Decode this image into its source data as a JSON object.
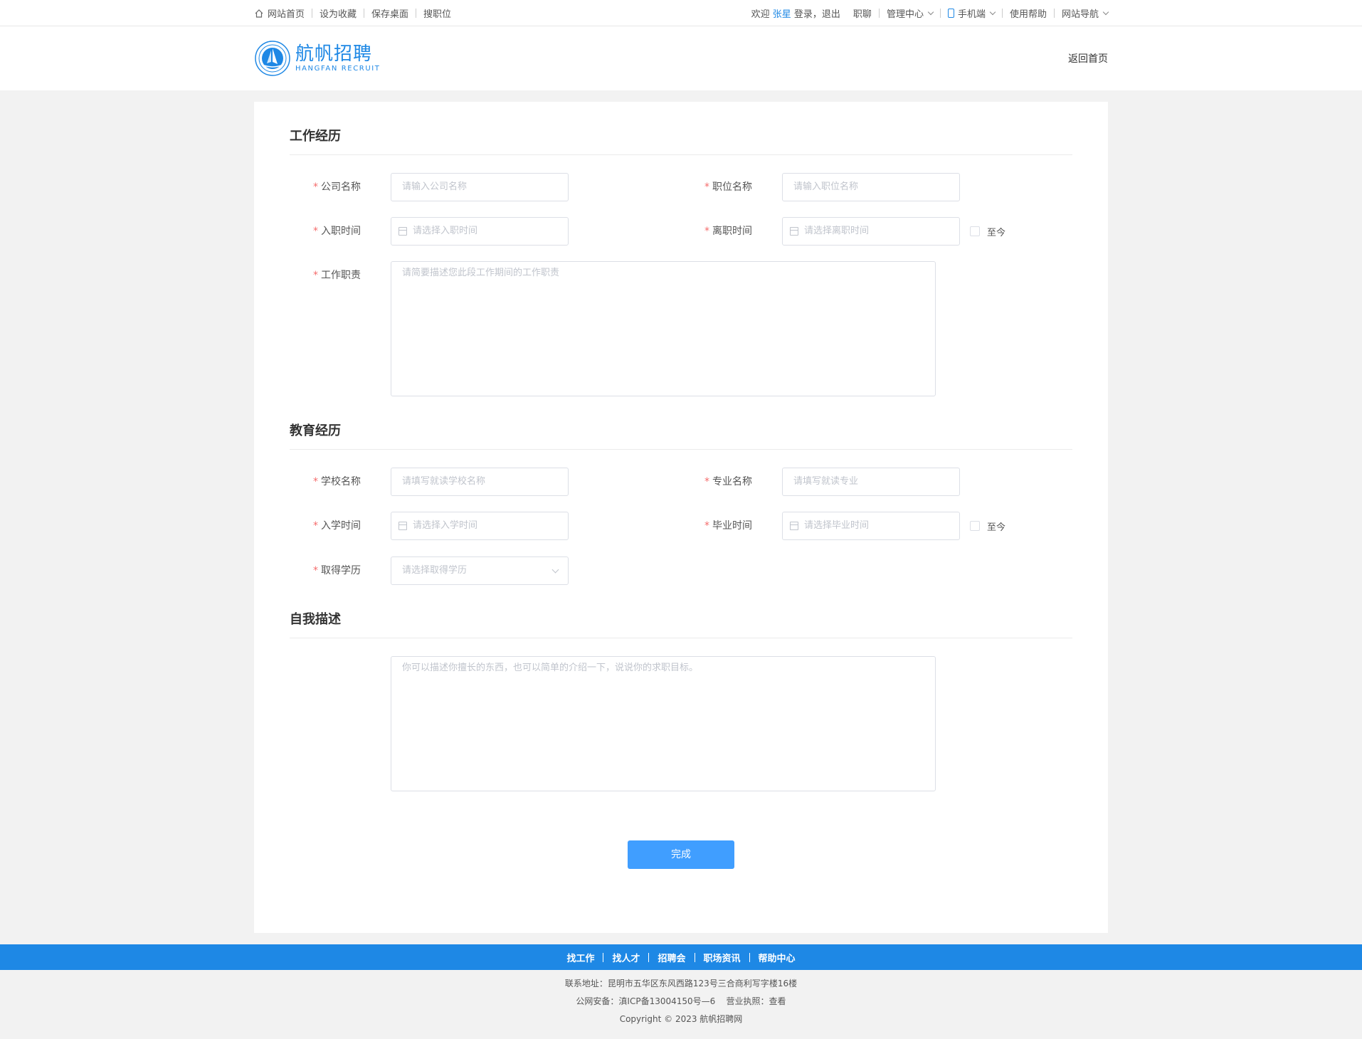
{
  "topbar": {
    "left_links": [
      "网站首页",
      "设为收藏",
      "保存桌面",
      "搜职位"
    ],
    "welcome": "欢迎",
    "username": "张星",
    "login": "登录",
    "comma": "，",
    "logout": "退出",
    "right_links": {
      "career_chat": "职聊",
      "admin_center": "管理中心",
      "mobile": "手机端",
      "help": "使用帮助",
      "site_nav": "网站导航"
    }
  },
  "header": {
    "logo_cn": "航帆招聘",
    "logo_en": "HANGFAN RECRUIT",
    "back_home": "返回首页"
  },
  "work": {
    "title": "工作经历",
    "company_label": "公司名称",
    "company_placeholder": "请输入公司名称",
    "position_label": "职位名称",
    "position_placeholder": "请输入职位名称",
    "start_label": "入职时间",
    "start_placeholder": "请选择入职时间",
    "end_label": "离职时间",
    "end_placeholder": "请选择离职时间",
    "until_now": "至今",
    "duty_label": "工作职责",
    "duty_placeholder": "请简要描述您此段工作期间的工作职责"
  },
  "education": {
    "title": "教育经历",
    "school_label": "学校名称",
    "school_placeholder": "请填写就读学校名称",
    "major_label": "专业名称",
    "major_placeholder": "请填写就读专业",
    "start_label": "入学时间",
    "start_placeholder": "请选择入学时间",
    "end_label": "毕业时间",
    "end_placeholder": "请选择毕业时间",
    "until_now": "至今",
    "degree_label": "取得学历",
    "degree_placeholder": "请选择取得学历"
  },
  "self": {
    "title": "自我描述",
    "placeholder": "你可以描述你擅长的东西，也可以简单的介绍一下，说说你的求职目标。"
  },
  "done_button": "完成",
  "required_mark": "*",
  "footer": {
    "nav": [
      "找工作",
      "找人才",
      "招聘会",
      "职场资讯",
      "帮助中心"
    ],
    "address": "联系地址：昆明市五华区东风西路123号三合商利写字楼16楼",
    "record": "公网安备：滇ICP备13004150号—6    营业执照：查看",
    "copyright": "Copyright © 2023 航帆招聘网"
  },
  "colors": {
    "accent": "#1e88e5",
    "button": "#409eff",
    "required": "#f56c6c"
  }
}
